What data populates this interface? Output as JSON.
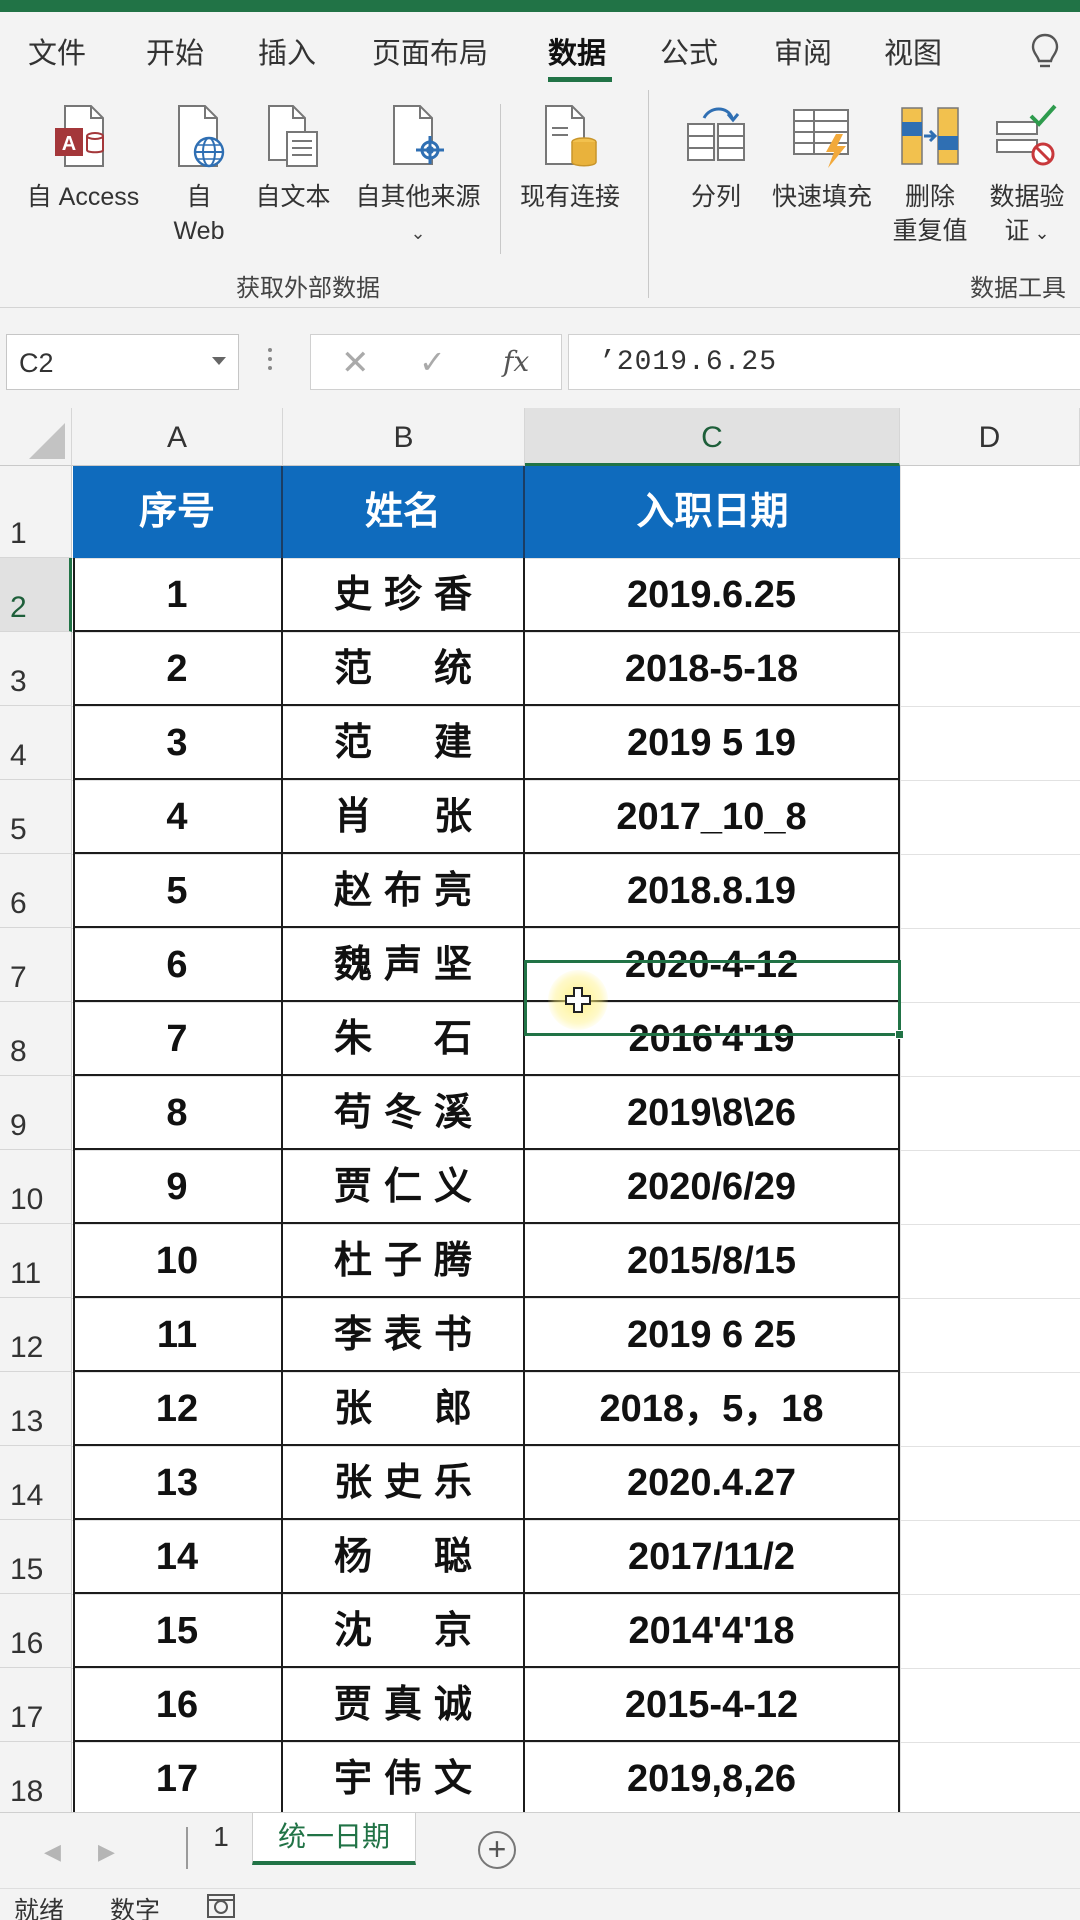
{
  "ribbon": {
    "tabs": [
      {
        "label": "文件",
        "active": false
      },
      {
        "label": "开始",
        "active": false
      },
      {
        "label": "插入",
        "active": false
      },
      {
        "label": "页面布局",
        "active": false
      },
      {
        "label": "数据",
        "active": true
      },
      {
        "label": "公式",
        "active": false
      },
      {
        "label": "审阅",
        "active": false
      },
      {
        "label": "视图",
        "active": false
      }
    ],
    "get_external_data": {
      "from_access": "自 Access",
      "from_web_line1": "自",
      "from_web_line2": "Web",
      "from_text": "自文本",
      "from_other": "自其他来源",
      "existing_connections": "现有连接",
      "group_label": "获取外部数据"
    },
    "data_tools": {
      "text_to_columns": "分列",
      "flash_fill": "快速填充",
      "remove_dup_line1": "删除",
      "remove_dup_line2": "重复值",
      "validation_line1": "数据验",
      "validation_line2": "证",
      "group_label": "数据工具"
    }
  },
  "formula_bar": {
    "name_box": "C2",
    "cancel_symbol": "✕",
    "enter_symbol": "✓",
    "fx_symbol": "fx",
    "content": "’2019.6.25"
  },
  "grid": {
    "columns": [
      "A",
      "B",
      "C",
      "D"
    ],
    "row_numbers": [
      "1",
      "2",
      "3",
      "4",
      "5",
      "6",
      "7",
      "8",
      "9",
      "10",
      "11",
      "12",
      "13",
      "14",
      "15",
      "16",
      "17",
      "18"
    ],
    "table_headers": [
      "序号",
      "姓名",
      "入职日期"
    ],
    "rows": [
      {
        "no": "1",
        "name": "史珍香",
        "date": "2019.6.25"
      },
      {
        "no": "2",
        "name": "范　统",
        "date": "2018-5-18"
      },
      {
        "no": "3",
        "name": "范　建",
        "date": "2019 5 19"
      },
      {
        "no": "4",
        "name": "肖　张",
        "date": "2017_10_8"
      },
      {
        "no": "5",
        "name": "赵布亮",
        "date": "2018.8.19"
      },
      {
        "no": "6",
        "name": "魏声坚",
        "date": "2020-4-12"
      },
      {
        "no": "7",
        "name": "朱　石",
        "date": "2016'4'19"
      },
      {
        "no": "8",
        "name": "苟冬溪",
        "date": "2019\\8\\26"
      },
      {
        "no": "9",
        "name": "贾仁义",
        "date": "2020/6/29"
      },
      {
        "no": "10",
        "name": "杜子腾",
        "date": "2015/8/15"
      },
      {
        "no": "11",
        "name": "李表书",
        "date": "2019 6 25"
      },
      {
        "no": "12",
        "name": "张　郎",
        "date": "2018，5，18"
      },
      {
        "no": "13",
        "name": "张史乐",
        "date": "2020.4.27"
      },
      {
        "no": "14",
        "name": "杨　聪",
        "date": "2017/11/2"
      },
      {
        "no": "15",
        "name": "沈　京",
        "date": "2014'4'18"
      },
      {
        "no": "16",
        "name": "贾真诚",
        "date": "2015-4-12"
      },
      {
        "no": "17",
        "name": "宇伟文",
        "date": "2019,8,26"
      }
    ]
  },
  "sheets": {
    "tabs": [
      "1",
      "统一日期"
    ],
    "active": "统一日期",
    "add_symbol": "+"
  },
  "status": {
    "ready": "就绪",
    "mode": "数字"
  },
  "colors": {
    "accent": "#217346",
    "header_fill": "#0f6bbd",
    "header_text": "#ffffff"
  }
}
